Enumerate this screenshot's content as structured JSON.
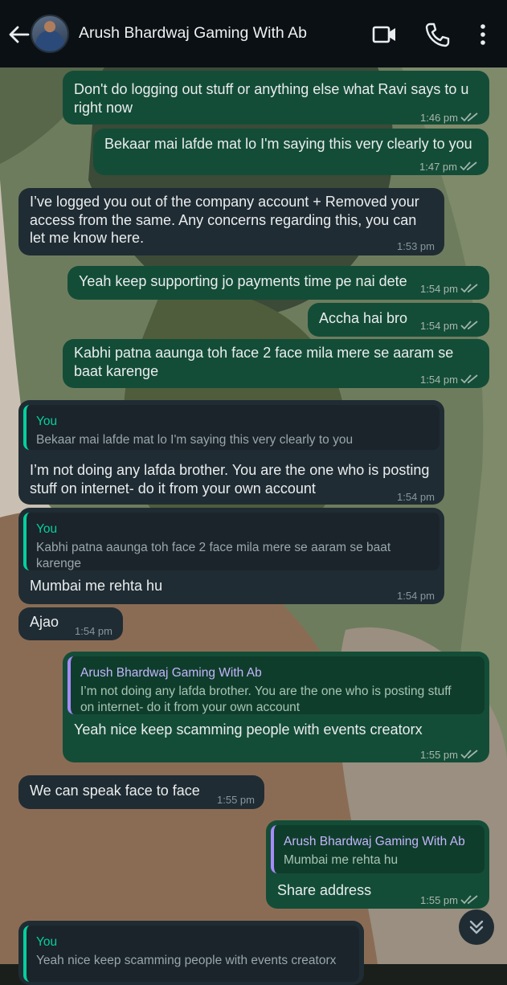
{
  "header": {
    "title": "Arush Bhardwaj Gaming With Ab",
    "icons": [
      "back-arrow-icon",
      "avatar",
      "video-call-icon",
      "voice-call-icon",
      "more-options-icon"
    ]
  },
  "colors": {
    "header_bg": "#0b1014",
    "outgoing_bubble": "#144d37",
    "incoming_bubble": "#202c33",
    "quote_accent_in": "#06cf9c",
    "quote_accent_out": "#a78bfa"
  },
  "messages": [
    {
      "dir": "out",
      "lines": [
        "Don't do logging out stuff or anything else what Ravi says to u",
        "right now"
      ],
      "time": "1:46 pm"
    },
    {
      "dir": "out",
      "lines": [
        "Bekaar mai lafde mat lo I'm saying this very clearly to you"
      ],
      "time": "1:47 pm"
    },
    {
      "dir": "in",
      "lines": [
        "I’ve logged you out of the company account + Removed your",
        "access from the same. Any concerns regarding this, you can",
        "let me know here."
      ],
      "time": "1:53 pm"
    },
    {
      "dir": "out",
      "lines": [
        "Yeah keep supporting jo payments time pe nai dete"
      ],
      "time": "1:54 pm"
    },
    {
      "dir": "out",
      "lines": [
        "Accha hai bro"
      ],
      "time": "1:54 pm"
    },
    {
      "dir": "out",
      "lines": [
        "Kabhi patna aaunga toh face 2 face mila mere se aaram se",
        "baat karenge"
      ],
      "time": "1:54 pm"
    },
    {
      "dir": "in",
      "quote": {
        "name": "You",
        "lines": [
          "Bekaar mai lafde mat lo I'm saying this very clearly to you"
        ]
      },
      "lines": [
        "I’m not doing any lafda brother. You are the one who is posting",
        "stuff on internet- do it from your own account"
      ],
      "time": "1:54 pm"
    },
    {
      "dir": "in",
      "quote": {
        "name": "You",
        "lines": [
          "Kabhi patna aaunga toh face 2 face mila mere se aaram se baat",
          "karenge"
        ]
      },
      "lines": [
        "Mumbai me rehta hu"
      ],
      "time": "1:54 pm"
    },
    {
      "dir": "in",
      "lines": [
        "Ajao"
      ],
      "time": "1:54 pm"
    },
    {
      "dir": "out",
      "quote": {
        "name": "Arush Bhardwaj Gaming With Ab",
        "lines": [
          "I’m not doing any lafda brother. You are the one who is posting stuff",
          "on internet- do it from your own account"
        ]
      },
      "lines": [
        "Yeah nice keep scamming people with events creatorx"
      ],
      "time": "1:55 pm"
    },
    {
      "dir": "in",
      "lines": [
        "We can speak face to face"
      ],
      "time": "1:55 pm"
    },
    {
      "dir": "out",
      "quote": {
        "name": "Arush Bhardwaj Gaming With Ab",
        "lines": [
          "Mumbai me rehta hu"
        ]
      },
      "lines": [
        "Share address"
      ],
      "time": "1:55 pm"
    },
    {
      "dir": "in",
      "quote": {
        "name": "You",
        "lines": [
          "Yeah nice keep scamming people with events creatorx"
        ]
      },
      "lines": [],
      "time": ""
    }
  ],
  "scroll_down_button": "double-chevron-down-icon"
}
